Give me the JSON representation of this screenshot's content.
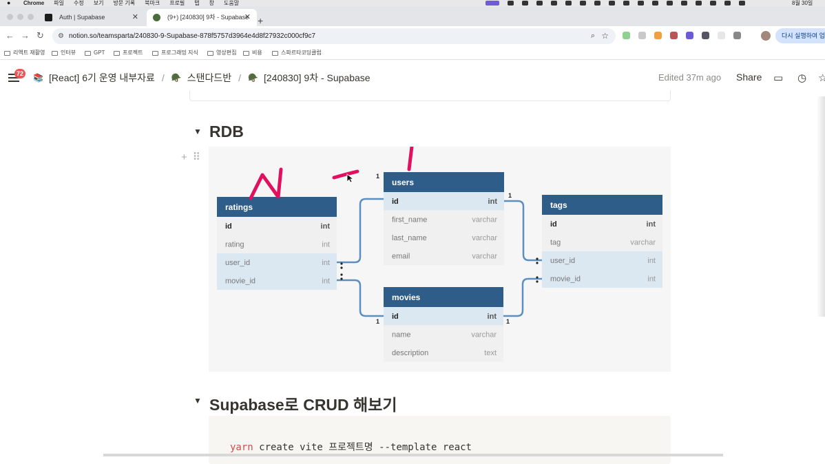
{
  "mac_menu": {
    "app": "Chrome",
    "items": [
      "파일",
      "수정",
      "보기",
      "방문 기록",
      "북마크",
      "프로필",
      "탭",
      "창",
      "도움말"
    ],
    "clock": "8월 30일"
  },
  "tabs": [
    {
      "title": "Auth | Supabase",
      "close": "✕"
    },
    {
      "title": "(9+) [240830] 9차 - Supabase",
      "close": "✕"
    }
  ],
  "new_tab": "+",
  "address": {
    "url": "notion.so/teamsparta/240830-9-Supabase-878f5757d3964e4d8f27932c000cf9c7"
  },
  "relaunch_label": "다시 실행하여 업데이트",
  "bookmarks": [
    "리액트 재활영",
    "인터뷰",
    "GPT",
    "프로젝트",
    "프로그래밍 지식",
    "영상편집",
    "비용",
    "스파르타코딩클럽"
  ],
  "notion_header": {
    "badge": "72",
    "crumbs": [
      "[React] 6기 운영 내부자료",
      "스탠다드반",
      "[240830] 9차 - Supabase"
    ],
    "edited": "Edited 37m ago",
    "share": "Share"
  },
  "section_rdb": "RDB",
  "section_crud": "Supabase로 CRUD 해보기",
  "code_line": {
    "cmd": "yarn",
    "rest": " create vite 프로젝트명 --template react"
  },
  "diagram": {
    "tables": {
      "ratings": {
        "title": "ratings",
        "rows": [
          [
            "id",
            "int"
          ],
          [
            "rating",
            "int"
          ],
          [
            "user_id",
            "int"
          ],
          [
            "movie_id",
            "int"
          ]
        ]
      },
      "users": {
        "title": "users",
        "rows": [
          [
            "id",
            "int"
          ],
          [
            "first_name",
            "varchar"
          ],
          [
            "last_name",
            "varchar"
          ],
          [
            "email",
            "varchar"
          ]
        ]
      },
      "movies": {
        "title": "movies",
        "rows": [
          [
            "id",
            "int"
          ],
          [
            "name",
            "varchar"
          ],
          [
            "description",
            "text"
          ]
        ]
      },
      "tags": {
        "title": "tags",
        "rows": [
          [
            "id",
            "int"
          ],
          [
            "tag",
            "varchar"
          ],
          [
            "user_id",
            "int"
          ],
          [
            "movie_id",
            "int"
          ]
        ]
      }
    },
    "cardinality_one": "1",
    "header_color": "#2f5d8a",
    "highlight_color": "#dbe7f1",
    "line_color": "#5b8fc0",
    "annotation_color": "#e0115f"
  }
}
